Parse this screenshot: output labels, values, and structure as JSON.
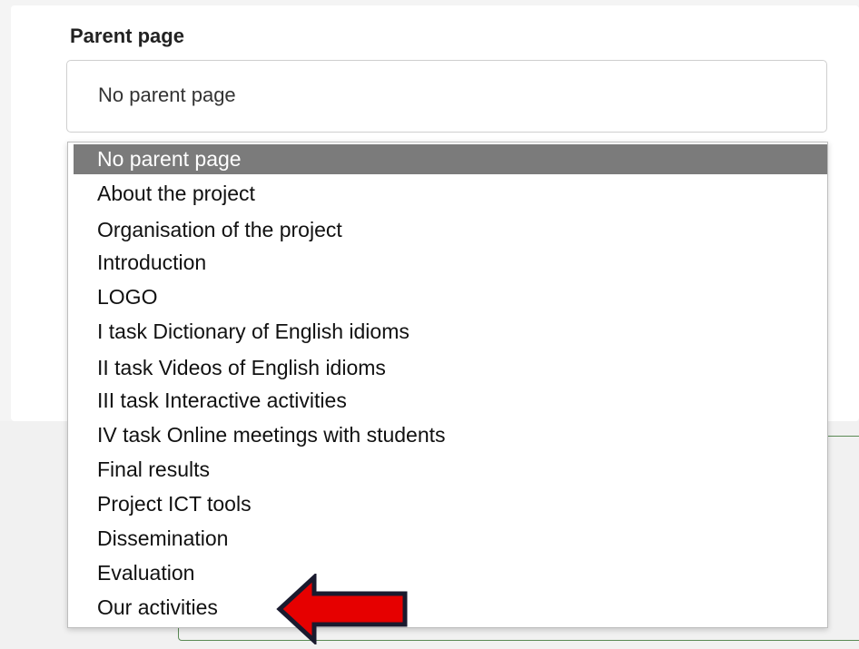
{
  "form": {
    "parent_label": "Parent page",
    "select_value": "No parent page"
  },
  "dropdown": {
    "options": [
      {
        "label": "No parent page",
        "selected": true
      },
      {
        "label": "About the project",
        "selected": false
      },
      {
        "label": "Organisation of the project",
        "selected": false
      },
      {
        "label": "Introduction",
        "selected": false
      },
      {
        "label": "LOGO",
        "selected": false
      },
      {
        "label": "I task Dictionary of English idioms",
        "selected": false
      },
      {
        "label": "II task Videos of English idioms",
        "selected": false
      },
      {
        "label": "III task Interactive activities",
        "selected": false
      },
      {
        "label": "IV task Online meetings with students",
        "selected": false
      },
      {
        "label": "Final results",
        "selected": false
      },
      {
        "label": "Project ICT tools",
        "selected": false
      },
      {
        "label": "Dissemination",
        "selected": false
      },
      {
        "label": "Evaluation",
        "selected": false
      },
      {
        "label": "Our activities",
        "selected": false
      }
    ]
  },
  "annotation": {
    "arrow_icon": "left-arrow-icon",
    "arrow_color": "#e60000",
    "arrow_outline": "#1a1a2e"
  },
  "colors": {
    "selected_option_bg": "#7b7b7b",
    "green_border": "#5a8a55"
  }
}
